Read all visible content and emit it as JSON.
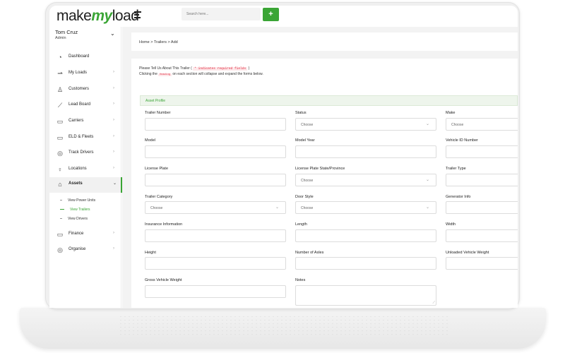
{
  "brand": {
    "logo_pre": "make",
    "logo_my": "my",
    "logo_post": "load"
  },
  "topbar": {
    "search_placeholder": "Search here...",
    "add_label": "+"
  },
  "user": {
    "name": "Tom Cruz",
    "role": "Admin"
  },
  "sidebar": {
    "items": [
      {
        "label": "Dashboard",
        "icon": "dashboard-icon"
      },
      {
        "label": "My Loads",
        "icon": "truck-icon"
      },
      {
        "label": "Customers",
        "icon": "add-user-icon"
      },
      {
        "label": "Lead Board",
        "icon": "chart-icon"
      },
      {
        "label": "Carriers",
        "icon": "truck-icon"
      },
      {
        "label": "ELD & Fleets",
        "icon": "fleet-icon"
      },
      {
        "label": "Track Drivers",
        "icon": "location-pin-icon"
      },
      {
        "label": "Locations",
        "icon": "map-pin-icon"
      },
      {
        "label": "Assets",
        "icon": "lock-icon"
      },
      {
        "label": "Finance",
        "icon": "wallet-icon"
      },
      {
        "label": "Organise",
        "icon": "settings-icon"
      }
    ],
    "sub_items": [
      "View Power Units",
      "View Trailers",
      "View Drivers"
    ]
  },
  "breadcrumb": "Home > Trailers > Add",
  "intro": {
    "line1_pre": "Please Tell Us About This Trailer (",
    "required_tag": "* indicates required fields",
    "line1_post": ")",
    "line2_pre": "Clicking the",
    "heading_tag": "Heading",
    "line2_post": "on each section will collapse and expand the forms below."
  },
  "section": {
    "title": "Asset Profile"
  },
  "fields": {
    "trailer_number": "Trailer Number",
    "status": "Status",
    "make": "Make",
    "model": "Model",
    "model_year": "Model Year",
    "vin": "Vehicle ID Number",
    "license_plate": "License Plate",
    "plate_state": "License Plate State/Province",
    "trailer_type": "Trailer Type",
    "trailer_category": "Trailer Category",
    "door_style": "Door Style",
    "generator_info": "Generator Info",
    "insurance": "Insurance Information",
    "length": "Length",
    "width": "Width",
    "height": "Height",
    "axles": "Number of Axles",
    "unloaded_weight": "Unloaded Vehicle Weight",
    "gross_weight": "Gross Vehicle Weight",
    "notes": "Notes"
  },
  "select_placeholder": "Choose",
  "colors": {
    "accent": "#3aa535",
    "required": "#e0263b"
  }
}
